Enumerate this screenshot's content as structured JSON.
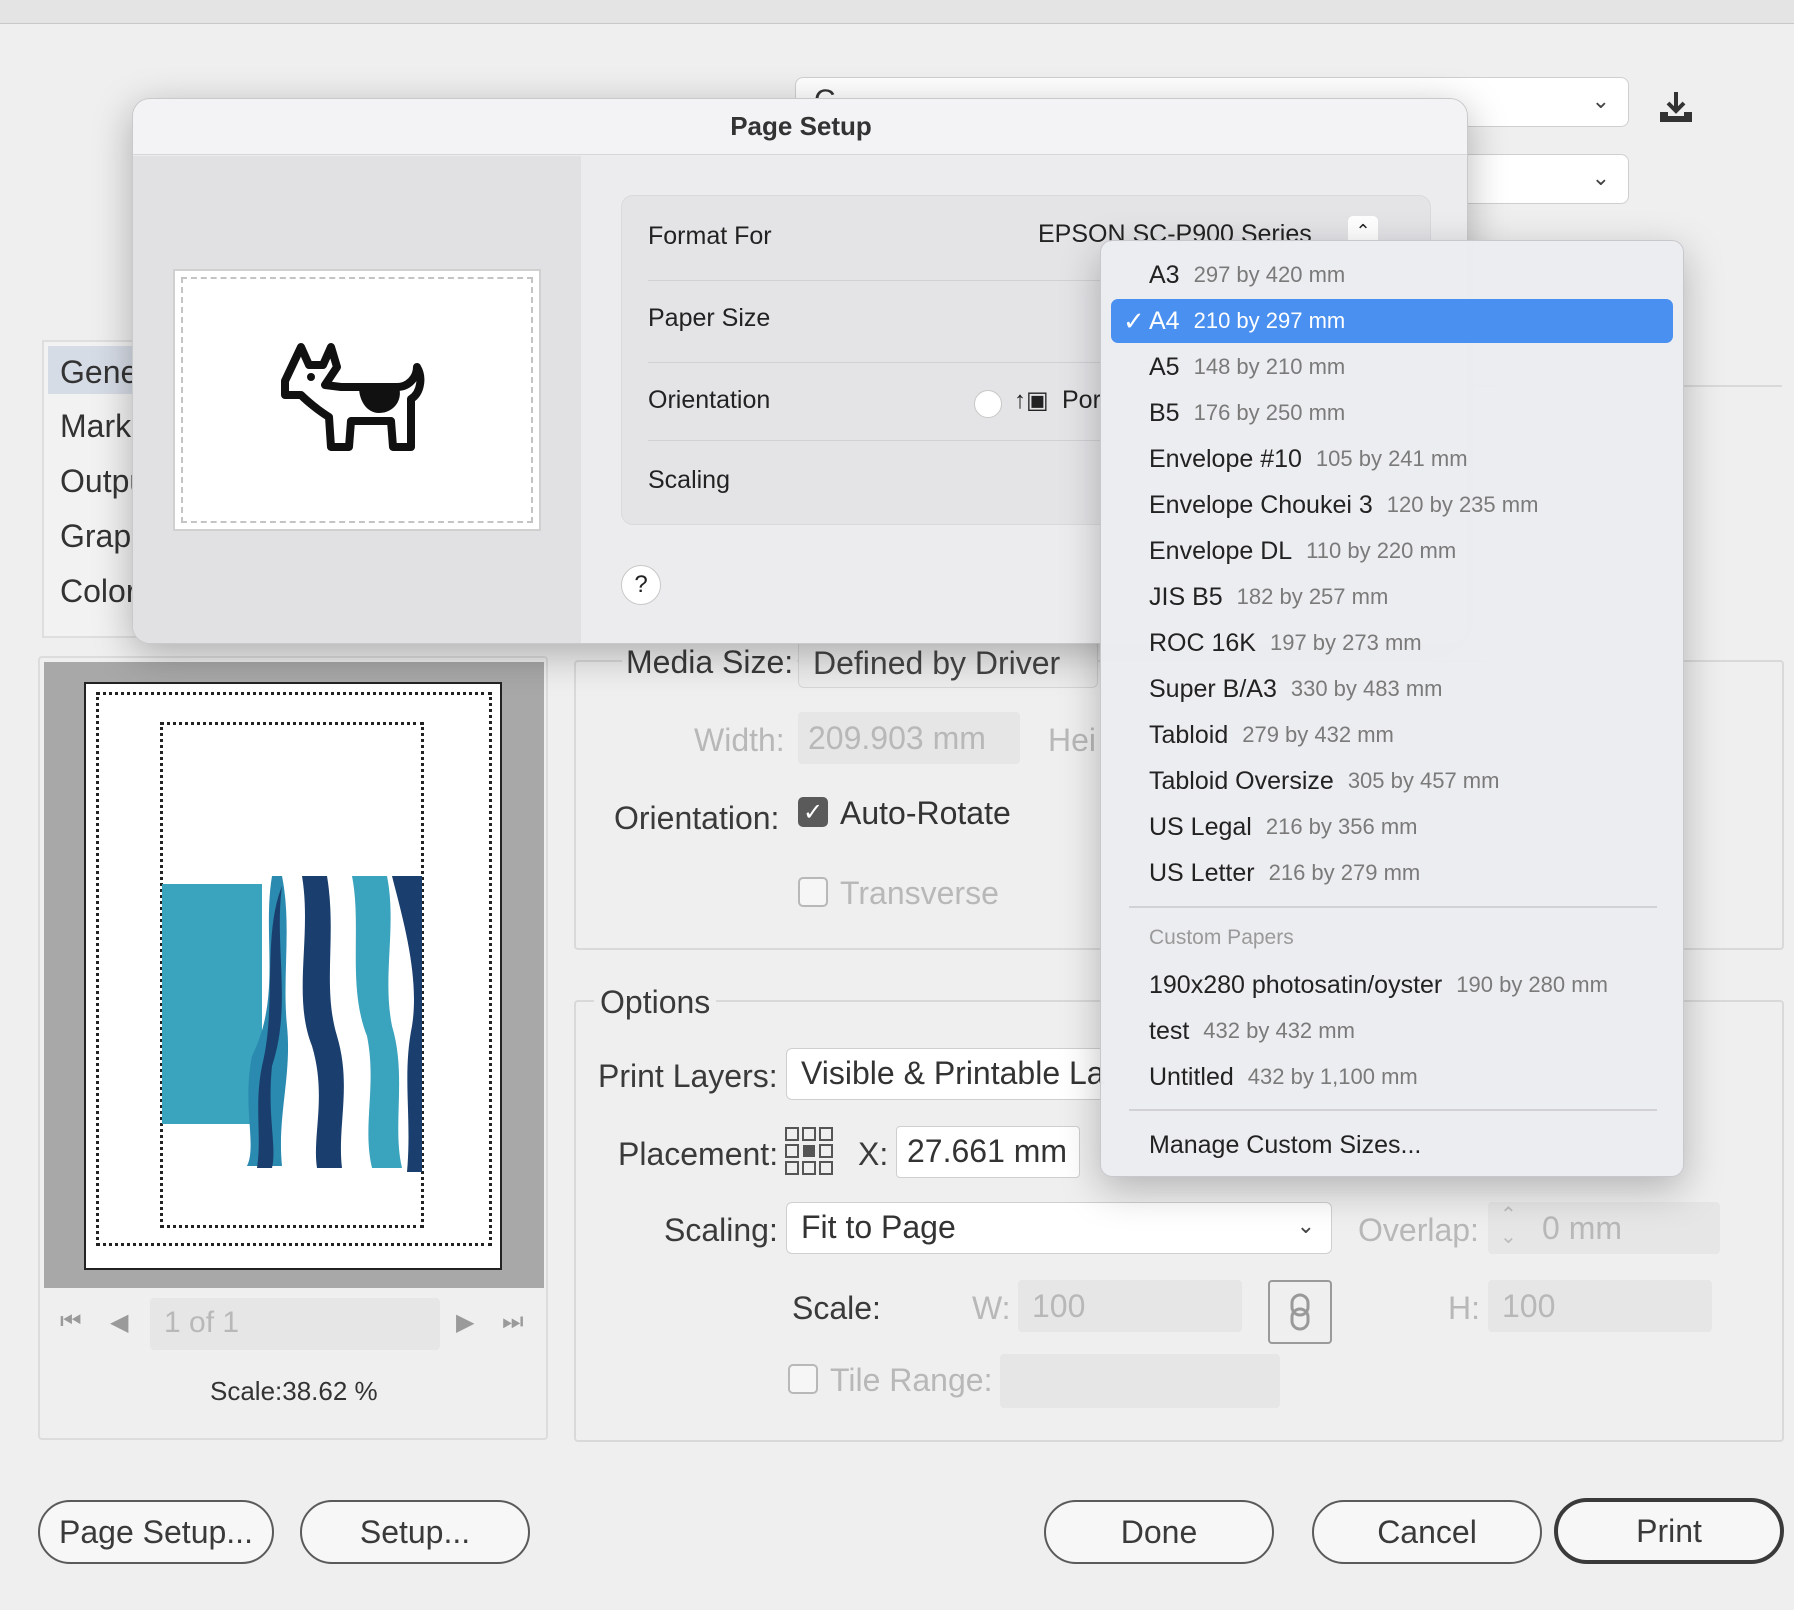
{
  "print_dialog": {
    "presets_dropdown_value": "C",
    "sidebar_items": [
      "General",
      "Marks and Bleed",
      "Output",
      "Graphics",
      "Color Management"
    ],
    "preview": {
      "page_field": "1 of 1",
      "scale_text": "Scale:38.62 %"
    },
    "media": {
      "size_label": "Media Size:",
      "size_value": "Defined by Driver",
      "width_label": "Width:",
      "width_value": "209.903 mm",
      "height_label": "Hei",
      "orientation_label": "Orientation:",
      "auto_rotate_label": "Auto-Rotate",
      "auto_rotate_checked": true,
      "transverse_label": "Transverse"
    },
    "options": {
      "title": "Options",
      "print_layers_label": "Print Layers:",
      "print_layers_value": "Visible & Printable La",
      "placement_label": "Placement:",
      "x_label": "X:",
      "x_value": "27.661 mm",
      "scaling_label": "Scaling:",
      "scaling_value": "Fit to Page",
      "overlap_label": "Overlap:",
      "overlap_value": "0 mm",
      "scale_label": "Scale:",
      "w_label": "W:",
      "w_value": "100",
      "h_label": "H:",
      "h_value": "100",
      "tile_range_label": "Tile Range:"
    },
    "buttons": {
      "page_setup": "Page Setup...",
      "setup": "Setup...",
      "done": "Done",
      "cancel": "Cancel",
      "print": "Print"
    }
  },
  "page_setup_sheet": {
    "title": "Page Setup",
    "format_for_label": "Format For",
    "format_for_value": "EPSON SC-P900 Series",
    "paper_size_label": "Paper Size",
    "orientation_label": "Orientation",
    "orientation_portrait_label": "Por",
    "scaling_label": "Scaling",
    "help_label": "?"
  },
  "paper_size_menu": {
    "items": [
      {
        "name": "A3",
        "dims": "297 by 420 mm",
        "selected": false
      },
      {
        "name": "A4",
        "dims": "210 by 297 mm",
        "selected": true
      },
      {
        "name": "A5",
        "dims": "148 by 210 mm",
        "selected": false
      },
      {
        "name": "B5",
        "dims": "176 by 250 mm",
        "selected": false
      },
      {
        "name": "Envelope #10",
        "dims": "105 by 241 mm",
        "selected": false
      },
      {
        "name": "Envelope Choukei 3",
        "dims": "120 by 235 mm",
        "selected": false
      },
      {
        "name": "Envelope DL",
        "dims": "110 by 220 mm",
        "selected": false
      },
      {
        "name": "JIS B5",
        "dims": "182 by 257 mm",
        "selected": false
      },
      {
        "name": "ROC 16K",
        "dims": "197 by 273 mm",
        "selected": false
      },
      {
        "name": "Super B/A3",
        "dims": "330 by 483 mm",
        "selected": false
      },
      {
        "name": "Tabloid",
        "dims": "279 by 432 mm",
        "selected": false
      },
      {
        "name": "Tabloid Oversize",
        "dims": "305 by 457 mm",
        "selected": false
      },
      {
        "name": "US Legal",
        "dims": "216 by 356 mm",
        "selected": false
      },
      {
        "name": "US Letter",
        "dims": "216 by 279 mm",
        "selected": false
      }
    ],
    "custom_header": "Custom Papers",
    "custom_items": [
      {
        "name": "190x280 photosatin/oyster",
        "dims": "190 by 280 mm"
      },
      {
        "name": "test",
        "dims": "432 by 432 mm"
      },
      {
        "name": "Untitled",
        "dims": "432 by 1,100 mm"
      }
    ],
    "manage_label": "Manage Custom Sizes...",
    "selected_color": "#4a90f0"
  },
  "icons": [
    "save-preset-icon",
    "chevron-down-icon",
    "dog-cow-icon",
    "checkmark-icon",
    "portrait-icon",
    "link-icon",
    "first-page-icon",
    "prev-page-icon",
    "next-page-icon",
    "last-page-icon",
    "placement-grid-icon",
    "stepper-icon"
  ],
  "artwork_colors": [
    "#3aa3bd",
    "#1a3f6e",
    "#ffffff"
  ]
}
